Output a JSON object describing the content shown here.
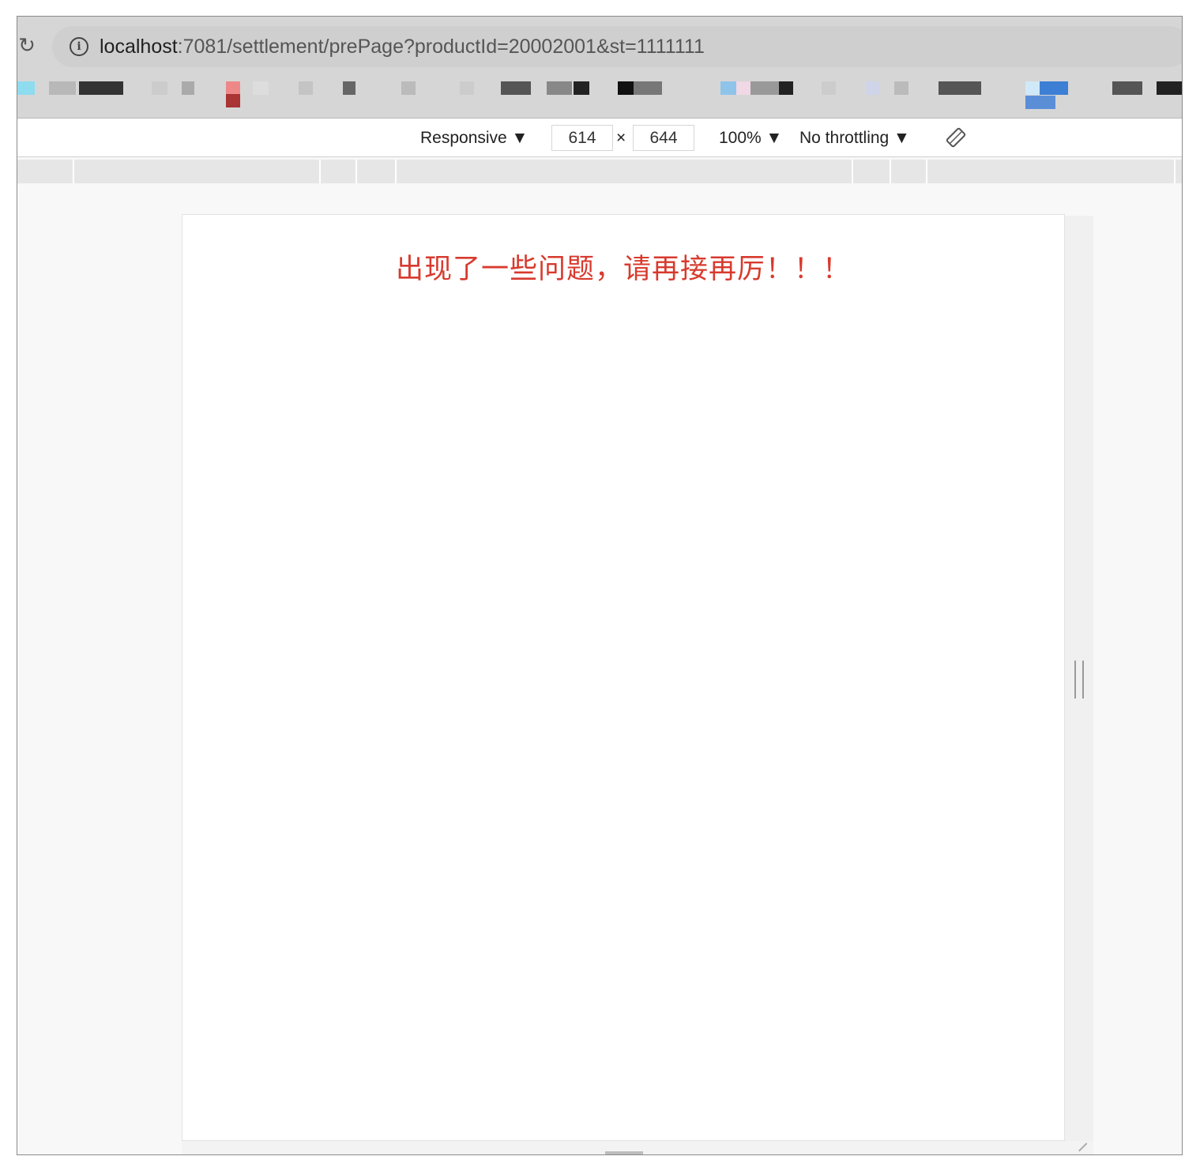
{
  "address_bar": {
    "host": "localhost",
    "path": ":7081/settlement/prePage?productId=20002001&st=1111111"
  },
  "icons": {
    "reload": "reload-icon",
    "info": "info-icon",
    "rotate": "rotate-icon"
  },
  "device_toolbar": {
    "device_mode": "Responsive ▼",
    "width": "614",
    "times": "×",
    "height": "644",
    "zoom": "100% ▼",
    "throttling": "No throttling ▼"
  },
  "page": {
    "error_message": "出现了一些问题，请再接再厉！！！"
  },
  "colors": {
    "error_text": "#d83a2e",
    "chrome_bg": "#d6d6d6",
    "toolbar_bg": "#ffffff"
  }
}
